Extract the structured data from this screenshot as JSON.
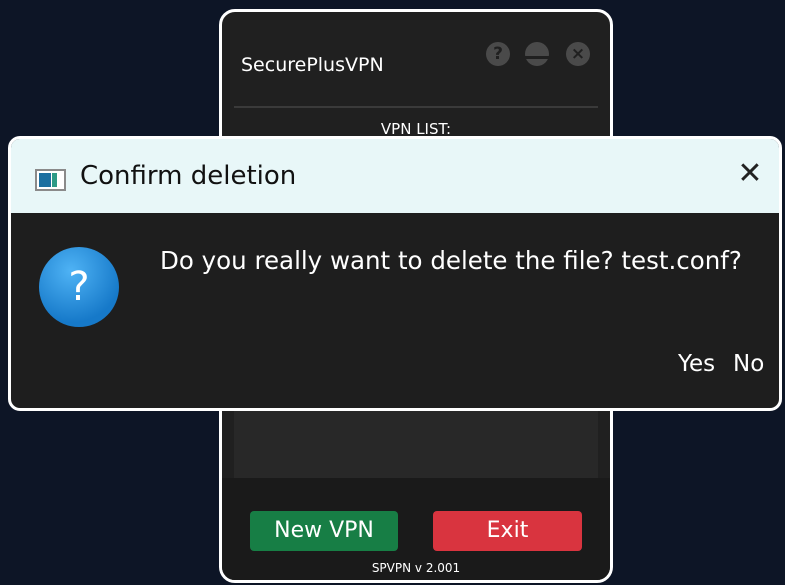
{
  "app": {
    "title": "SecurePlusVPN",
    "window_controls": {
      "help_icon": "?",
      "close_icon": "×"
    },
    "vpn_list_label": "VPN LIST:",
    "new_vpn_label": "New VPN",
    "exit_label": "Exit",
    "version": "SPVPN v 2.001"
  },
  "dialog": {
    "title": "Confirm deletion",
    "close_icon": "✕",
    "question_icon": "?",
    "message": "Do you really want to delete the file? test.conf?",
    "yes_label": "Yes",
    "no_label": "No"
  },
  "colors": {
    "background": "#0d1526",
    "app_bg": "#202020",
    "new_vpn_button": "#177e45",
    "exit_button": "#d9343f",
    "dialog_titlebar": "#e8f7f8",
    "dialog_body": "#1e1e1e",
    "question_icon": "#1679c9"
  },
  "icons": {
    "app_icon": "window-app-icon",
    "help": "help-icon",
    "minimize": "minimize-icon",
    "close": "close-icon",
    "question": "question-icon"
  }
}
